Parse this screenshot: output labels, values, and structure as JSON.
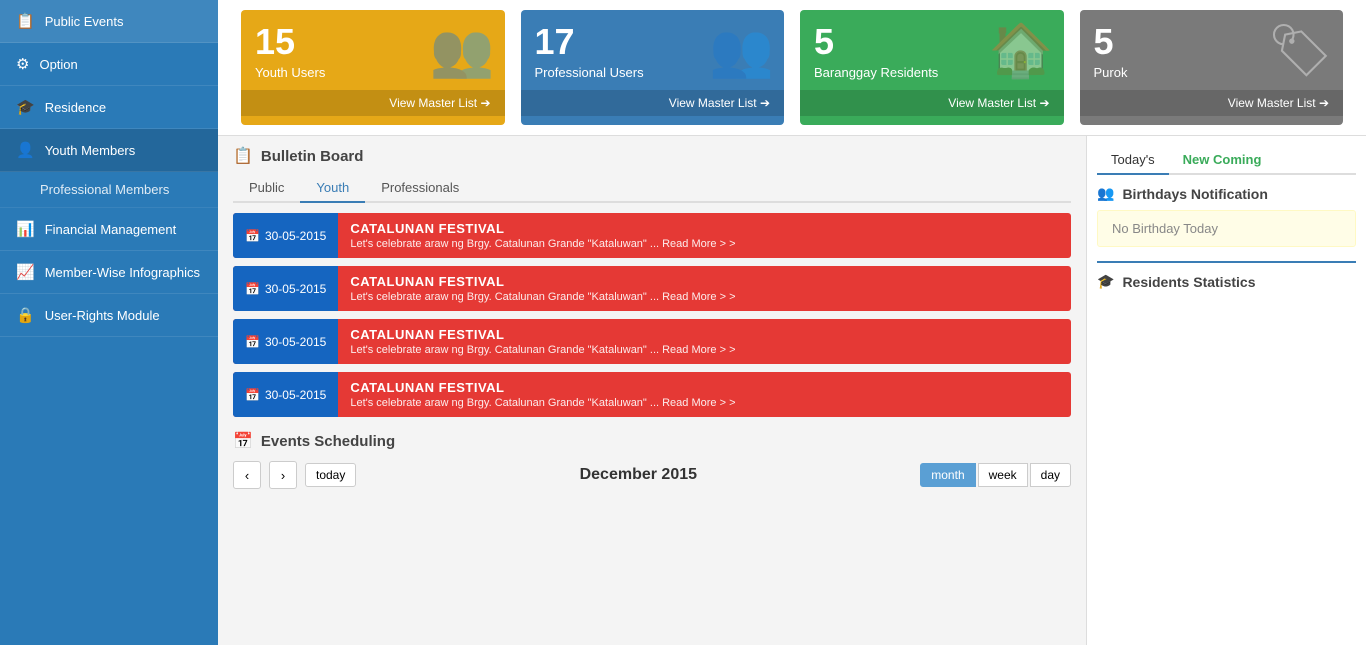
{
  "sidebar": {
    "items": [
      {
        "label": "Public Events",
        "icon": "📋",
        "id": "public-events"
      },
      {
        "label": "Option",
        "icon": "⚙",
        "id": "option"
      },
      {
        "label": "Residence",
        "icon": "🎓",
        "id": "residence"
      },
      {
        "label": "Youth Members",
        "icon": "👤",
        "id": "youth-members"
      },
      {
        "label": "Professional Members",
        "icon": "",
        "id": "professional-members",
        "sub": true
      },
      {
        "label": "Financial Management",
        "icon": "📊",
        "id": "financial-management"
      },
      {
        "label": "Member-Wise Infographics",
        "icon": "📈",
        "id": "member-infographics"
      },
      {
        "label": "User-Rights Module",
        "icon": "🔒",
        "id": "user-rights"
      }
    ]
  },
  "stats": [
    {
      "id": "youth-users",
      "number": "15",
      "label": "Youth Users",
      "footer": "View Master List ➔",
      "color": "card-orange",
      "icon": "👥"
    },
    {
      "id": "professional-users",
      "number": "17",
      "label": "Professional Users",
      "footer": "View Master List ➔",
      "color": "card-blue",
      "icon": "👥"
    },
    {
      "id": "baranggay-residents",
      "number": "5",
      "label": "Baranggay Residents",
      "footer": "View Master List ➔",
      "color": "card-green",
      "icon": "🏠"
    },
    {
      "id": "purok",
      "number": "5",
      "label": "Purok",
      "footer": "View Master List ➔",
      "color": "card-gray",
      "icon": "🏷"
    }
  ],
  "bulletin": {
    "title": "Bulletin Board",
    "tabs": [
      "Public",
      "Youth",
      "Professionals"
    ],
    "active_tab": "Youth",
    "items": [
      {
        "date": "30-05-2015",
        "title": "CATALUNAN FESTIVAL",
        "desc": "Let's celebrate araw ng Brgy. Catalunan Grande \"Kataluwan\" ... Read More > >"
      },
      {
        "date": "30-05-2015",
        "title": "CATALUNAN FESTIVAL",
        "desc": "Let's celebrate araw ng Brgy. Catalunan Grande \"Kataluwan\" ... Read More > >"
      },
      {
        "date": "30-05-2015",
        "title": "CATALUNAN FESTIVAL",
        "desc": "Let's celebrate araw ng Brgy. Catalunan Grande \"Kataluwan\" ... Read More > >"
      },
      {
        "date": "30-05-2015",
        "title": "CATALUNAN FESTIVAL",
        "desc": "Let's celebrate araw ng Brgy. Catalunan Grande \"Kataluwan\" ... Read More > >"
      }
    ]
  },
  "events": {
    "title": "Events Scheduling",
    "month_label": "December 2015",
    "views": [
      "month",
      "week",
      "day"
    ],
    "active_view": "month",
    "today_label": "today"
  },
  "right_panel": {
    "birthday_tabs": [
      "Today's",
      "New Coming"
    ],
    "active_tab": "Today's",
    "birthday_title": "Birthdays Notification",
    "no_birthday_text": "No Birthday Today",
    "residents_stats_title": "Residents Statistics"
  }
}
